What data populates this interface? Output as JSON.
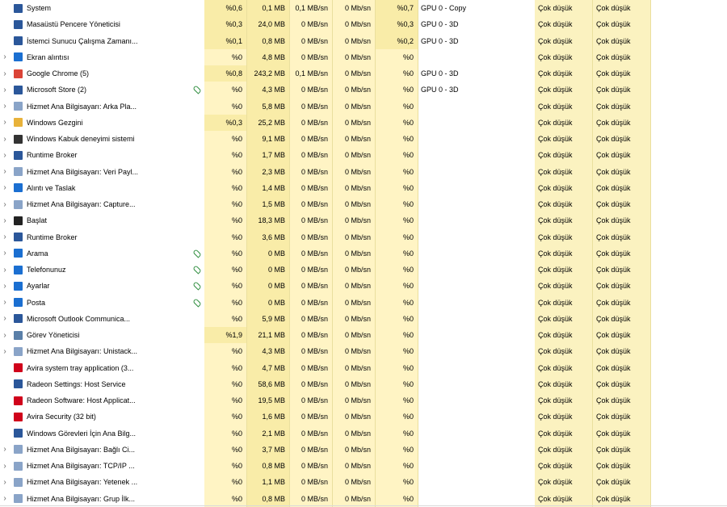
{
  "rows": [
    {
      "expand": false,
      "icon": "system-icon",
      "iconColor": "#2b579a",
      "name": "System",
      "status": "",
      "cpu": "%0,6",
      "mem": "0,1 MB",
      "disk": "0,1 MB/sn",
      "net": "0 Mb/sn",
      "gpu": "%0,7",
      "engine": "GPU 0 - Copy",
      "power": "Çok düşük",
      "trend": "Çok düşük"
    },
    {
      "expand": false,
      "icon": "window-icon",
      "iconColor": "#2b579a",
      "name": "Masaüstü Pencere Yöneticisi",
      "status": "",
      "cpu": "%0,3",
      "mem": "24,0 MB",
      "disk": "0 MB/sn",
      "net": "0 Mb/sn",
      "gpu": "%0,3",
      "engine": "GPU 0 - 3D",
      "power": "Çok düşük",
      "trend": "Çok düşük"
    },
    {
      "expand": false,
      "icon": "window-icon",
      "iconColor": "#2b579a",
      "name": "İstemci Sunucu Çalışma Zamanı...",
      "status": "",
      "cpu": "%0,1",
      "mem": "0,8 MB",
      "disk": "0 MB/sn",
      "net": "0 Mb/sn",
      "gpu": "%0,2",
      "engine": "GPU 0 - 3D",
      "power": "Çok düşük",
      "trend": "Çok düşük"
    },
    {
      "expand": true,
      "icon": "snip-icon",
      "iconColor": "#1b6fd1",
      "name": "Ekran alıntısı",
      "status": "",
      "cpu": "%0",
      "mem": "4,8 MB",
      "disk": "0 MB/sn",
      "net": "0 Mb/sn",
      "gpu": "%0",
      "engine": "",
      "power": "Çok düşük",
      "trend": "Çok düşük"
    },
    {
      "expand": true,
      "icon": "chrome-icon",
      "iconColor": "#db4437",
      "name": "Google Chrome (5)",
      "status": "",
      "cpu": "%0,8",
      "mem": "243,2 MB",
      "disk": "0,1 MB/sn",
      "net": "0 Mb/sn",
      "gpu": "%0",
      "engine": "GPU 0 - 3D",
      "power": "Çok düşük",
      "trend": "Çok düşük"
    },
    {
      "expand": true,
      "icon": "store-icon",
      "iconColor": "#2b579a",
      "name": "Microsoft Store (2)",
      "status": "leaf",
      "cpu": "%0",
      "mem": "4,3 MB",
      "disk": "0 MB/sn",
      "net": "0 Mb/sn",
      "gpu": "%0",
      "engine": "GPU 0 - 3D",
      "power": "Çok düşük",
      "trend": "Çok düşük"
    },
    {
      "expand": true,
      "icon": "service-icon",
      "iconColor": "#8aa4c8",
      "name": "Hizmet Ana Bilgisayarı: Arka Pla...",
      "status": "",
      "cpu": "%0",
      "mem": "5,8 MB",
      "disk": "0 MB/sn",
      "net": "0 Mb/sn",
      "gpu": "%0",
      "engine": "",
      "power": "Çok düşük",
      "trend": "Çok düşük"
    },
    {
      "expand": true,
      "icon": "folder-icon",
      "iconColor": "#e8b23a",
      "name": "Windows Gezgini",
      "status": "",
      "cpu": "%0,3",
      "mem": "25,2 MB",
      "disk": "0 MB/sn",
      "net": "0 Mb/sn",
      "gpu": "%0",
      "engine": "",
      "power": "Çok düşük",
      "trend": "Çok düşük"
    },
    {
      "expand": true,
      "icon": "shell-icon",
      "iconColor": "#333333",
      "name": "Windows Kabuk deneyimi sistemi",
      "status": "",
      "cpu": "%0",
      "mem": "9,1 MB",
      "disk": "0 MB/sn",
      "net": "0 Mb/sn",
      "gpu": "%0",
      "engine": "",
      "power": "Çok düşük",
      "trend": "Çok düşük"
    },
    {
      "expand": true,
      "icon": "window-icon",
      "iconColor": "#2b579a",
      "name": "Runtime Broker",
      "status": "",
      "cpu": "%0",
      "mem": "1,7 MB",
      "disk": "0 MB/sn",
      "net": "0 Mb/sn",
      "gpu": "%0",
      "engine": "",
      "power": "Çok düşük",
      "trend": "Çok düşük"
    },
    {
      "expand": true,
      "icon": "service-icon",
      "iconColor": "#8aa4c8",
      "name": "Hizmet Ana Bilgisayarı: Veri Payl...",
      "status": "",
      "cpu": "%0",
      "mem": "2,3 MB",
      "disk": "0 MB/sn",
      "net": "0 Mb/sn",
      "gpu": "%0",
      "engine": "",
      "power": "Çok düşük",
      "trend": "Çok düşük"
    },
    {
      "expand": true,
      "icon": "sketch-icon",
      "iconColor": "#1b6fd1",
      "name": "Alıntı ve Taslak",
      "status": "",
      "cpu": "%0",
      "mem": "1,4 MB",
      "disk": "0 MB/sn",
      "net": "0 Mb/sn",
      "gpu": "%0",
      "engine": "",
      "power": "Çok düşük",
      "trend": "Çok düşük"
    },
    {
      "expand": true,
      "icon": "service-icon",
      "iconColor": "#8aa4c8",
      "name": "Hizmet Ana Bilgisayarı: Capture...",
      "status": "",
      "cpu": "%0",
      "mem": "1,5 MB",
      "disk": "0 MB/sn",
      "net": "0 Mb/sn",
      "gpu": "%0",
      "engine": "",
      "power": "Çok düşük",
      "trend": "Çok düşük"
    },
    {
      "expand": true,
      "icon": "start-icon",
      "iconColor": "#222222",
      "name": "Başlat",
      "status": "",
      "cpu": "%0",
      "mem": "18,3 MB",
      "disk": "0 MB/sn",
      "net": "0 Mb/sn",
      "gpu": "%0",
      "engine": "",
      "power": "Çok düşük",
      "trend": "Çok düşük"
    },
    {
      "expand": true,
      "icon": "window-icon",
      "iconColor": "#2b579a",
      "name": "Runtime Broker",
      "status": "",
      "cpu": "%0",
      "mem": "3,6 MB",
      "disk": "0 MB/sn",
      "net": "0 Mb/sn",
      "gpu": "%0",
      "engine": "",
      "power": "Çok düşük",
      "trend": "Çok düşük"
    },
    {
      "expand": true,
      "icon": "search-icon",
      "iconColor": "#1b6fd1",
      "name": "Arama",
      "status": "leaf",
      "cpu": "%0",
      "mem": "0 MB",
      "disk": "0 MB/sn",
      "net": "0 Mb/sn",
      "gpu": "%0",
      "engine": "",
      "power": "Çok düşük",
      "trend": "Çok düşük"
    },
    {
      "expand": true,
      "icon": "phone-icon",
      "iconColor": "#1b6fd1",
      "name": "Telefonunuz",
      "status": "leaf",
      "cpu": "%0",
      "mem": "0 MB",
      "disk": "0 MB/sn",
      "net": "0 Mb/sn",
      "gpu": "%0",
      "engine": "",
      "power": "Çok düşük",
      "trend": "Çok düşük"
    },
    {
      "expand": true,
      "icon": "gear-icon",
      "iconColor": "#1b6fd1",
      "name": "Ayarlar",
      "status": "leaf",
      "cpu": "%0",
      "mem": "0 MB",
      "disk": "0 MB/sn",
      "net": "0 Mb/sn",
      "gpu": "%0",
      "engine": "",
      "power": "Çok düşük",
      "trend": "Çok düşük"
    },
    {
      "expand": true,
      "icon": "mail-icon",
      "iconColor": "#1b6fd1",
      "name": "Posta",
      "status": "leaf",
      "cpu": "%0",
      "mem": "0 MB",
      "disk": "0 MB/sn",
      "net": "0 Mb/sn",
      "gpu": "%0",
      "engine": "",
      "power": "Çok düşük",
      "trend": "Çok düşük"
    },
    {
      "expand": true,
      "icon": "window-icon",
      "iconColor": "#2b579a",
      "name": "Microsoft Outlook Communica...",
      "status": "",
      "cpu": "%0",
      "mem": "5,9 MB",
      "disk": "0 MB/sn",
      "net": "0 Mb/sn",
      "gpu": "%0",
      "engine": "",
      "power": "Çok düşük",
      "trend": "Çok düşük"
    },
    {
      "expand": true,
      "icon": "taskmgr-icon",
      "iconColor": "#5a7fa8",
      "name": "Görev Yöneticisi",
      "status": "",
      "cpu": "%1,9",
      "mem": "21,1 MB",
      "disk": "0 MB/sn",
      "net": "0 Mb/sn",
      "gpu": "%0",
      "engine": "",
      "power": "Çok düşük",
      "trend": "Çok düşük"
    },
    {
      "expand": true,
      "icon": "service-icon",
      "iconColor": "#8aa4c8",
      "name": "Hizmet Ana Bilgisayarı: Unistack...",
      "status": "",
      "cpu": "%0",
      "mem": "4,3 MB",
      "disk": "0 MB/sn",
      "net": "0 Mb/sn",
      "gpu": "%0",
      "engine": "",
      "power": "Çok düşük",
      "trend": "Çok düşük"
    },
    {
      "expand": false,
      "icon": "avira-tray-icon",
      "iconColor": "#d0021b",
      "name": "Avira system tray application (3...",
      "status": "",
      "cpu": "%0",
      "mem": "4,7 MB",
      "disk": "0 MB/sn",
      "net": "0 Mb/sn",
      "gpu": "%0",
      "engine": "",
      "power": "Çok düşük",
      "trend": "Çok düşük"
    },
    {
      "expand": false,
      "icon": "window-icon",
      "iconColor": "#2b579a",
      "name": "Radeon Settings: Host Service",
      "status": "",
      "cpu": "%0",
      "mem": "58,6 MB",
      "disk": "0 MB/sn",
      "net": "0 Mb/sn",
      "gpu": "%0",
      "engine": "",
      "power": "Çok düşük",
      "trend": "Çok düşük"
    },
    {
      "expand": false,
      "icon": "radeon-icon",
      "iconColor": "#d0021b",
      "name": "Radeon Software: Host Applicat...",
      "status": "",
      "cpu": "%0",
      "mem": "19,5 MB",
      "disk": "0 MB/sn",
      "net": "0 Mb/sn",
      "gpu": "%0",
      "engine": "",
      "power": "Çok düşük",
      "trend": "Çok düşük"
    },
    {
      "expand": false,
      "icon": "avira-icon",
      "iconColor": "#d0021b",
      "name": "Avira Security (32 bit)",
      "status": "",
      "cpu": "%0",
      "mem": "1,6 MB",
      "disk": "0 MB/sn",
      "net": "0 Mb/sn",
      "gpu": "%0",
      "engine": "",
      "power": "Çok düşük",
      "trend": "Çok düşük"
    },
    {
      "expand": false,
      "icon": "window-icon",
      "iconColor": "#2b579a",
      "name": "Windows Görevleri İçin Ana Bilg...",
      "status": "",
      "cpu": "%0",
      "mem": "2,1 MB",
      "disk": "0 MB/sn",
      "net": "0 Mb/sn",
      "gpu": "%0",
      "engine": "",
      "power": "Çok düşük",
      "trend": "Çok düşük"
    },
    {
      "expand": true,
      "icon": "service-icon",
      "iconColor": "#8aa4c8",
      "name": "Hizmet Ana Bilgisayarı: Bağlı Ci...",
      "status": "",
      "cpu": "%0",
      "mem": "3,7 MB",
      "disk": "0 MB/sn",
      "net": "0 Mb/sn",
      "gpu": "%0",
      "engine": "",
      "power": "Çok düşük",
      "trend": "Çok düşük"
    },
    {
      "expand": true,
      "icon": "service-icon",
      "iconColor": "#8aa4c8",
      "name": "Hizmet Ana Bilgisayarı: TCP/IP ...",
      "status": "",
      "cpu": "%0",
      "mem": "0,8 MB",
      "disk": "0 MB/sn",
      "net": "0 Mb/sn",
      "gpu": "%0",
      "engine": "",
      "power": "Çok düşük",
      "trend": "Çok düşük"
    },
    {
      "expand": true,
      "icon": "service-icon",
      "iconColor": "#8aa4c8",
      "name": "Hizmet Ana Bilgisayarı: Yetenek ...",
      "status": "",
      "cpu": "%0",
      "mem": "1,1 MB",
      "disk": "0 MB/sn",
      "net": "0 Mb/sn",
      "gpu": "%0",
      "engine": "",
      "power": "Çok düşük",
      "trend": "Çok düşük"
    },
    {
      "expand": true,
      "icon": "service-icon",
      "iconColor": "#8aa4c8",
      "name": "Hizmet Ana Bilgisayarı: Grup İlk...",
      "status": "",
      "cpu": "%0",
      "mem": "0,8 MB",
      "disk": "0 MB/sn",
      "net": "0 Mb/sn",
      "gpu": "%0",
      "engine": "",
      "power": "Çok düşük",
      "trend": "Çok düşük"
    }
  ]
}
